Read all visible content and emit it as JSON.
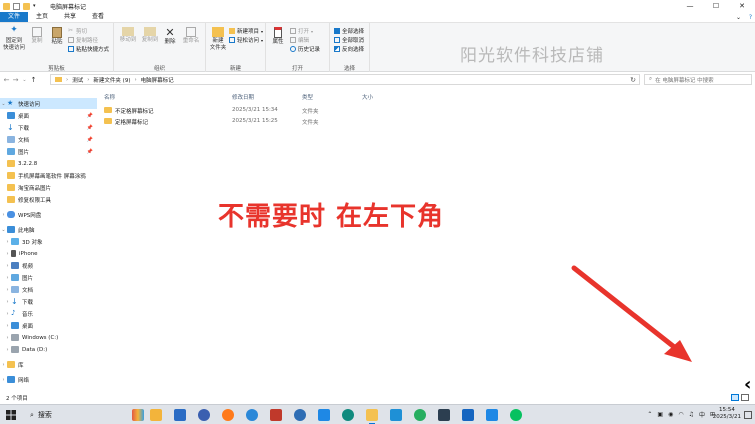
{
  "window": {
    "title": "电脑屏幕标记"
  },
  "tabs": [
    "文件",
    "主页",
    "共享",
    "查看"
  ],
  "ribbon": {
    "clipboard": {
      "pin_label_1": "固定到",
      "pin_label_2": "快速访问",
      "copy": "复制",
      "paste": "粘贴",
      "cut": "剪切",
      "copy_path": "复制路径",
      "paste_shortcut": "粘贴快捷方式",
      "group": "剪贴板"
    },
    "organize": {
      "move_to": "移动到",
      "copy_to": "复制到",
      "delete": "删除",
      "rename": "重命名",
      "group": "组织"
    },
    "new": {
      "new_folder_1": "新建",
      "new_folder_2": "文件夹",
      "new_item": "新建项目",
      "easy_access": "轻松访问",
      "group": "新建"
    },
    "open": {
      "properties": "属性",
      "open": "打开",
      "edit": "编辑",
      "history": "历史记录",
      "group": "打开"
    },
    "select": {
      "select_all": "全部选择",
      "select_none": "全部取消",
      "invert": "反向选择",
      "group": "选择"
    }
  },
  "watermark": "阳光软件科技店铺",
  "address": {
    "crumbs": [
      "测试",
      "新建文件夹 (9)",
      "电脑屏幕标记"
    ],
    "search_placeholder": "在 电脑屏幕标记 中搜索"
  },
  "navpane": {
    "quick_access": "快速访问",
    "items": [
      "桌面",
      "下载",
      "文档",
      "图片",
      "3.2.2.8",
      "手机屏幕画笔软件 屏幕涂鸦",
      "淘宝商品图片",
      "修复权限工具"
    ],
    "wps": "WPS网盘",
    "this_pc": "此电脑",
    "pc_items": [
      "3D 对象",
      "iPhone",
      "视频",
      "图片",
      "文档",
      "下载",
      "音乐",
      "桌面",
      "Windows (C:)",
      "Data (D:)"
    ],
    "library": "库",
    "network": "网络"
  },
  "filelist": {
    "columns": [
      "名称",
      "修改日期",
      "类型",
      "大小"
    ],
    "rows": [
      {
        "name": "不定格屏幕标记",
        "date": "2025/3/21 15:34",
        "type": "文件夹"
      },
      {
        "name": "定格屏幕标记",
        "date": "2025/3/21 15:25",
        "type": "文件夹"
      }
    ]
  },
  "annotation": "不需要时 在左下角",
  "status": {
    "count": "2 个项目"
  },
  "taskbar": {
    "search": "搜索",
    "time": "15:54",
    "date": "2025/3/21",
    "ime": "中"
  },
  "colors": {
    "accent": "#1979ca",
    "annotation": "#e8342c",
    "selection": "#cce8ff"
  }
}
